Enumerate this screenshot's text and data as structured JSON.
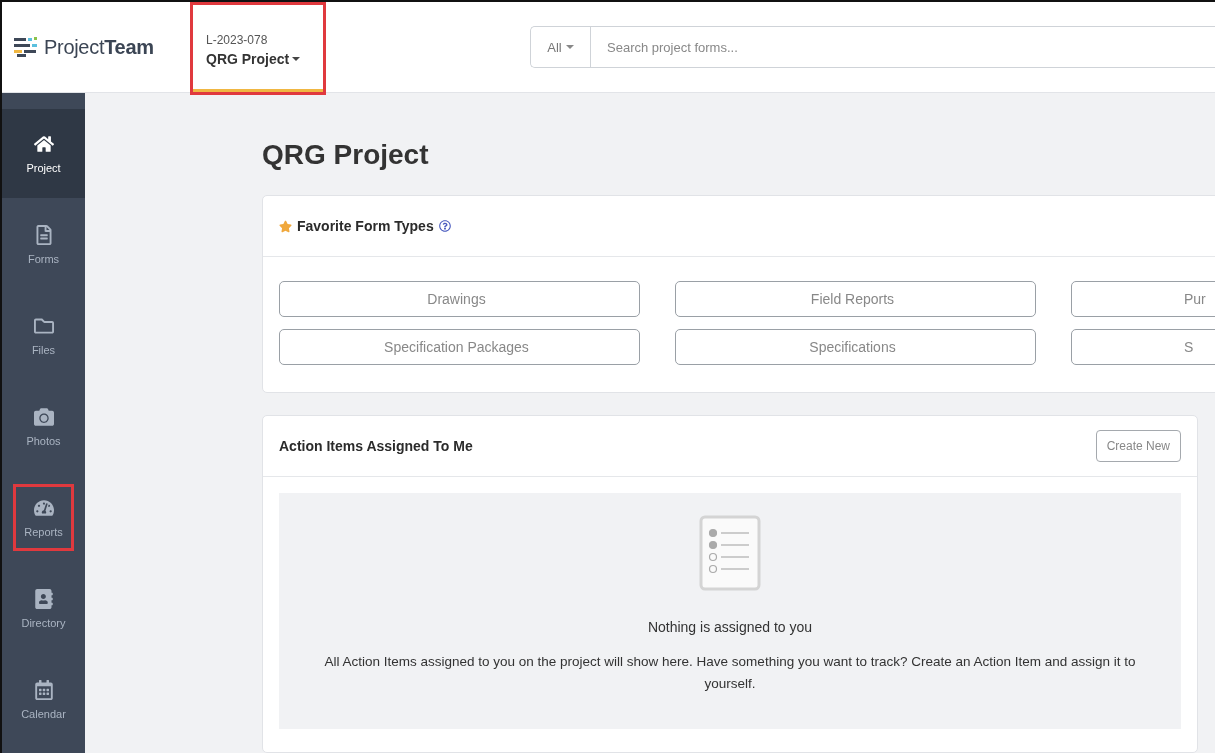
{
  "header": {
    "logo": "Project**Team**",
    "project_selector": {
      "code": "L-2023-078",
      "name": "QRG Project",
      "highlighted": true
    },
    "search": {
      "scope": "All",
      "placeholder": "Search project forms..."
    }
  },
  "sidebar": {
    "items": [
      {
        "kind": "home",
        "label": "Project",
        "selected": true,
        "highlighted": false
      },
      {
        "kind": "forms",
        "label": "Forms",
        "selected": false,
        "highlighted": false
      },
      {
        "kind": "files",
        "label": "Files",
        "selected": false,
        "highlighted": false
      },
      {
        "kind": "photos",
        "label": "Photos",
        "selected": false,
        "highlighted": false
      },
      {
        "kind": "reports",
        "label": "Reports",
        "selected": false,
        "highlighted": true
      },
      {
        "kind": "directory",
        "label": "Directory",
        "selected": false,
        "highlighted": false
      },
      {
        "kind": "calendar",
        "label": "Calendar",
        "selected": false,
        "highlighted": false
      }
    ]
  },
  "page_title": "QRG Project",
  "favorites": {
    "title": "Favorite Form Types",
    "form_types": [
      {
        "label": "Drawings",
        "cut": false
      },
      {
        "label": "Field Reports",
        "cut": false
      },
      {
        "label": "Pur",
        "cut": true
      },
      {
        "label": "Specification Packages",
        "cut": false
      },
      {
        "label": "Specifications",
        "cut": false
      },
      {
        "label": "S",
        "cut": true
      }
    ]
  },
  "action_items": {
    "title": "Action Items Assigned To Me",
    "button": "Create New",
    "empty_title": "Nothing is assigned to you",
    "empty_text": "All Action Items assigned to you on the project will show here. Have something you want to track? Create an Action Item and assign it to yourself."
  }
}
